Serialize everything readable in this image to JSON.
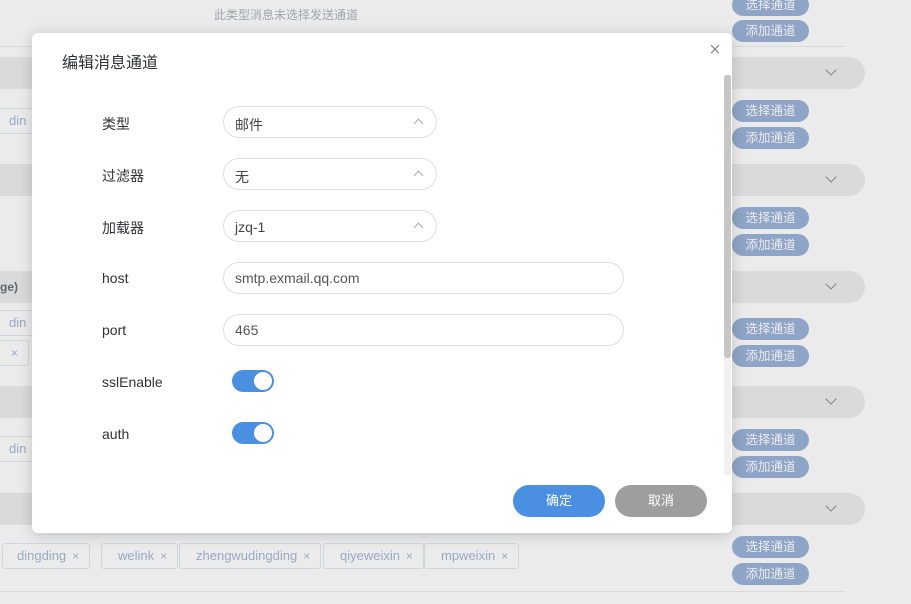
{
  "background": {
    "note": "此类型消息未选择发送通道",
    "select_channel": "选择通道",
    "add_channel": "添加通道",
    "side_fragment": "ge)",
    "tag_fragment": "din",
    "tag_fragment2": "ding",
    "tags": [
      "dingding",
      "welink",
      "zhengwudingding",
      "qiyeweixin",
      "mpweixin"
    ],
    "tag_close": "×"
  },
  "dialog": {
    "title": "编辑消息通道",
    "close": "×",
    "fields": {
      "type": {
        "label": "类型",
        "value": "邮件"
      },
      "filter": {
        "label": "过滤器",
        "value": "无"
      },
      "loader": {
        "label": "加载器",
        "value": "jzq-1"
      },
      "host": {
        "label": "host",
        "value": "smtp.exmail.qq.com"
      },
      "port": {
        "label": "port",
        "value": "465"
      },
      "ssl": {
        "label": "sslEnable",
        "on": true
      },
      "auth": {
        "label": "auth",
        "on": true
      }
    },
    "confirm": "确定",
    "cancel": "取消"
  },
  "colors": {
    "primary": "#4a8fe2",
    "cancel": "#9e9e9e",
    "pill": "#9cb4d8"
  }
}
